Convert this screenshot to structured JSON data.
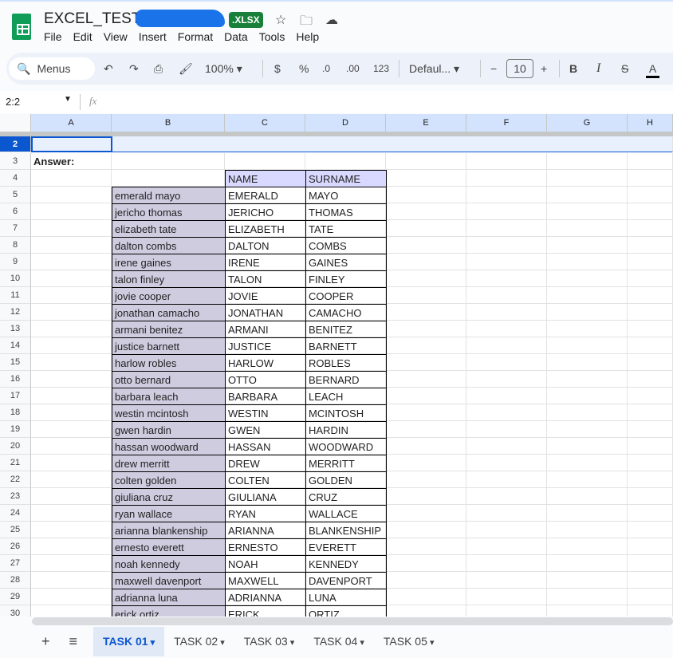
{
  "doc": {
    "title": "EXCEL_TEST_-_",
    "badge": ".XLSX"
  },
  "menu": [
    "File",
    "Edit",
    "View",
    "Insert",
    "Format",
    "Data",
    "Tools",
    "Help"
  ],
  "toolbar": {
    "search": "Menus",
    "zoom": "100%",
    "currency": "$",
    "percent": "%",
    "dec_down": ".0",
    "dec_up": ".00",
    "format": "123",
    "font": "Defaul...",
    "font_size": "10",
    "bold": "B",
    "italic": "I",
    "strike": "S",
    "text_color": "A"
  },
  "formula": {
    "name_box": "2:2",
    "fx": "fx",
    "value": ""
  },
  "columns": [
    "A",
    "B",
    "C",
    "D",
    "E",
    "F",
    "G",
    "H"
  ],
  "answer_label": "Answer:",
  "headers": {
    "name": "NAME",
    "surname": "SURNAME"
  },
  "rows": [
    [
      "emerald mayo",
      "EMERALD",
      "MAYO"
    ],
    [
      "jericho thomas",
      "JERICHO",
      "THOMAS"
    ],
    [
      "elizabeth tate",
      "ELIZABETH",
      "TATE"
    ],
    [
      "dalton combs",
      "DALTON",
      "COMBS"
    ],
    [
      "irene gaines",
      "IRENE",
      "GAINES"
    ],
    [
      "talon finley",
      "TALON",
      "FINLEY"
    ],
    [
      "jovie cooper",
      "JOVIE",
      "COOPER"
    ],
    [
      "jonathan camacho",
      "JONATHAN",
      "CAMACHO"
    ],
    [
      "armani benitez",
      "ARMANI",
      "BENITEZ"
    ],
    [
      "justice barnett",
      "JUSTICE",
      "BARNETT"
    ],
    [
      "harlow robles",
      "HARLOW",
      "ROBLES"
    ],
    [
      "otto bernard",
      "OTTO",
      "BERNARD"
    ],
    [
      "barbara leach",
      "BARBARA",
      "LEACH"
    ],
    [
      "westin mcintosh",
      "WESTIN",
      "MCINTOSH"
    ],
    [
      "gwen hardin",
      "GWEN",
      "HARDIN"
    ],
    [
      "hassan woodward",
      "HASSAN",
      "WOODWARD"
    ],
    [
      "drew merritt",
      "DREW",
      "MERRITT"
    ],
    [
      "colten golden",
      "COLTEN",
      "GOLDEN"
    ],
    [
      "giuliana cruz",
      "GIULIANA",
      "CRUZ"
    ],
    [
      "ryan wallace",
      "RYAN",
      "WALLACE"
    ],
    [
      "arianna blankenship",
      "ARIANNA",
      "BLANKENSHIP"
    ],
    [
      "ernesto everett",
      "ERNESTO",
      "EVERETT"
    ],
    [
      "noah kennedy",
      "NOAH",
      "KENNEDY"
    ],
    [
      "maxwell davenport",
      "MAXWELL",
      "DAVENPORT"
    ],
    [
      "adrianna luna",
      "ADRIANNA",
      "LUNA"
    ],
    [
      "erick ortiz",
      "ERICK",
      "ORTIZ"
    ]
  ],
  "sheets": [
    {
      "label": "TASK 01",
      "active": true
    },
    {
      "label": "TASK 02"
    },
    {
      "label": "TASK 03"
    },
    {
      "label": "TASK 04"
    },
    {
      "label": "TASK 05"
    }
  ],
  "colors": {
    "accent": "#0b57d0",
    "header_fill": "#d9d9ff",
    "source_fill": "#d0cce0",
    "badge": "#188038"
  }
}
